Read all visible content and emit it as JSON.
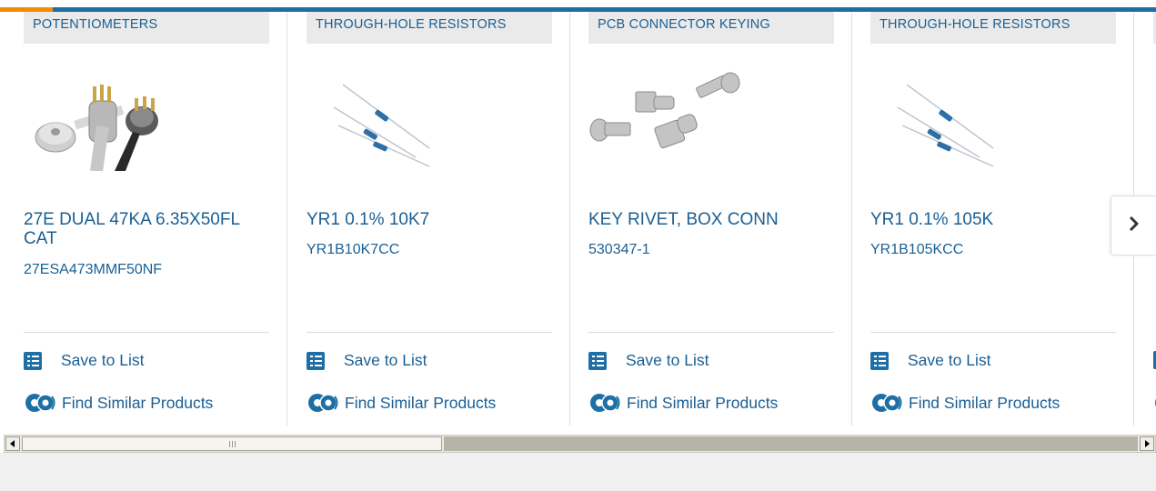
{
  "products": [
    {
      "category": "POTENTIOMETERS",
      "name": "27E DUAL 47KA 6.35X50FL CAT",
      "sku": "27ESA473MMF50NF",
      "image": "potentiometer-image",
      "save_label": "Save to List",
      "similar_label": "Find Similar Products"
    },
    {
      "category": "THROUGH-HOLE RESISTORS",
      "name": "YR1 0.1% 10K7",
      "sku": "YR1B10K7CC",
      "image": "resistor-image",
      "save_label": "Save to List",
      "similar_label": "Find Similar Products"
    },
    {
      "category": "PCB CONNECTOR KEYING",
      "name": "KEY RIVET, BOX CONN",
      "sku": "530347-1",
      "image": "key-rivet-image",
      "save_label": "Save to List",
      "similar_label": "Find Similar Products"
    },
    {
      "category": "THROUGH-HOLE RESISTORS",
      "name": "YR1 0.1% 105K",
      "sku": "YR1B105KCC",
      "image": "resistor-image",
      "save_label": "Save to List",
      "similar_label": "Find Similar Products"
    }
  ],
  "carousel": {
    "next_icon": "chevron-right-icon"
  },
  "colors": {
    "brand_blue": "#1d6fa5",
    "link_blue": "#1a5f94",
    "accent_orange": "#f28c00",
    "category_bg": "#eaeaea"
  },
  "icons": {
    "save": "checklist-icon",
    "similar": "gears-icon"
  }
}
